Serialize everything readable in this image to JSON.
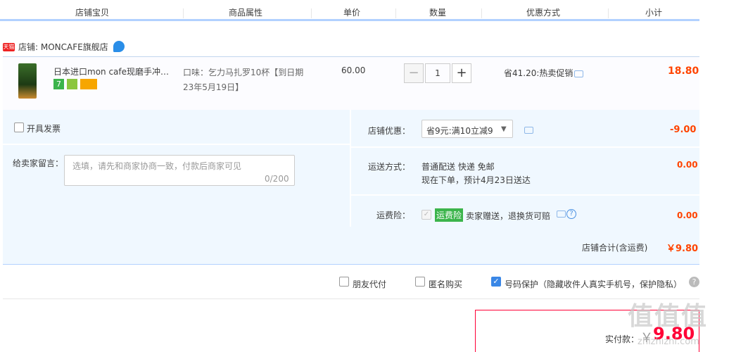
{
  "header": {
    "col_shop_item": "店铺宝贝",
    "col_attr": "商品属性",
    "col_price": "单价",
    "col_qty": "数量",
    "col_discount": "优惠方式",
    "col_subtotal": "小计"
  },
  "shop": {
    "badge": "天猫",
    "name": "店铺: MONCAFE旗舰店"
  },
  "item": {
    "title": "日本进口mon cafe现磨手冲挂耳咖啡",
    "badge_seven": "7",
    "sku": "口味：乞力马扎罗10杯【到日期23年5月19日】",
    "price": "60.00",
    "qty_minus": "−",
    "qty": "1",
    "qty_plus": "+",
    "promo": "省41.20:热卖促销",
    "subtotal": "18.80"
  },
  "options": {
    "invoice_label": "开具发票",
    "message_label": "给卖家留言：",
    "message_placeholder": "选填，请先和商家协商一致，付款后商家可见",
    "message_count": "0/200",
    "shop_discount_label": "店铺优惠：",
    "shop_discount_value": "省9元:满10立减9",
    "shop_discount_amount": "-9.00",
    "shipping_label": "运送方式：",
    "shipping_method": "普通配送 快递 免邮",
    "shipping_eta": "现在下单，预计4月23日送达",
    "shipping_amount": "0.00",
    "insurance_label": "运费险：",
    "insurance_tag": "运费险",
    "insurance_desc": "卖家赠送，退换货可赔",
    "insurance_amount": "0.00",
    "shop_total_label": "店铺合计(含运费)",
    "shop_total_value": "￥9.80"
  },
  "checkout": {
    "friend_pay": "朋友代付",
    "anonymous": "匿名购买",
    "privacy": "号码保护（隐藏收件人真实手机号，保护隐私）",
    "pay_label": "实付款：",
    "currency": "￥",
    "pay_value": "9.80"
  },
  "watermark": {
    "big": "值值值",
    "small": "zhizhizhi.com"
  }
}
